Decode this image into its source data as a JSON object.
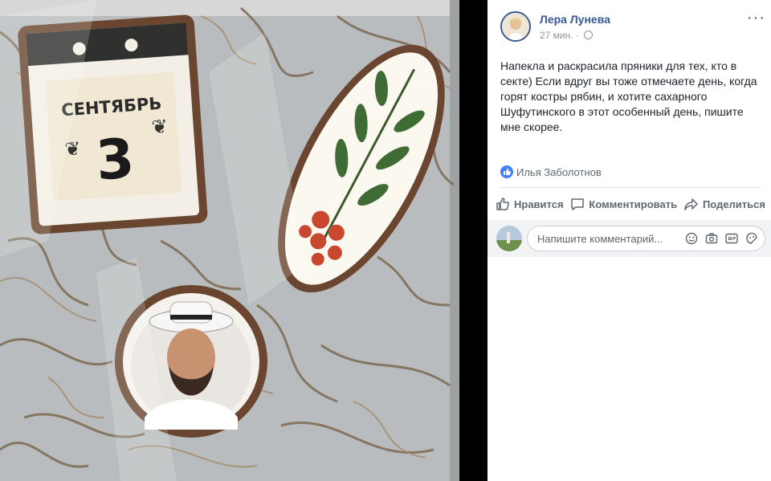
{
  "post": {
    "author": "Лера Лунева",
    "time": "27 мин.",
    "separator": "·",
    "more": "···",
    "text": "Напекла и раскрасила пряники для тех, кто в секте) Если вдруг вы тоже отмечаете день, когда горят костры рябин, и хотите сахарного Шуфутинского в этот особенный день, пишите мне скорее.",
    "reactions": "Илья Заболотнов"
  },
  "actions": {
    "like": "Нравится",
    "comment": "Комментировать",
    "share": "Поделиться"
  },
  "comment_box": {
    "placeholder": "Напишите комментарий..."
  },
  "photo": {
    "calendar_month": "СЕНТЯБРЬ",
    "calendar_day": "3"
  },
  "colors": {
    "link": "#385898",
    "text": "#1d2129",
    "muted": "#90949c",
    "like_blue": "#4080ff"
  },
  "icons": [
    "globe-icon",
    "more-icon",
    "like-reaction-icon",
    "thumbs-up-icon",
    "comment-icon",
    "share-icon",
    "emoji-icon",
    "camera-icon",
    "gif-icon",
    "sticker-icon"
  ]
}
